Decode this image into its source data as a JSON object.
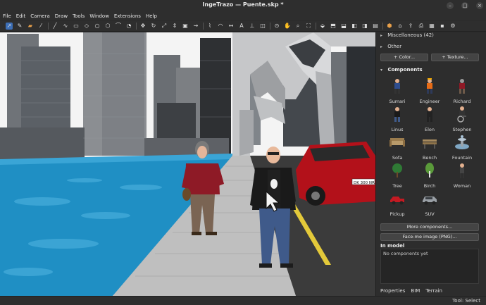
{
  "window": {
    "title": "IngeTrazo — Puente.skp *",
    "controls": [
      "minimize-icon",
      "maximize-icon",
      "close-icon"
    ]
  },
  "menu": [
    "File",
    "Edit",
    "Camera",
    "Draw",
    "Tools",
    "Window",
    "Extensions",
    "Help"
  ],
  "toolbar": {
    "tools": [
      "select-icon",
      "paint-bucket-icon",
      "eraser-icon",
      "eyedropper-icon",
      "line-icon",
      "freehand-icon",
      "rectangle-icon",
      "rotated-rectangle-icon",
      "circle-icon",
      "polygon-icon",
      "arc-icon",
      "pie-icon",
      "move-icon",
      "rotate-icon",
      "scale-icon",
      "push-pull-icon",
      "offset-icon",
      "follow-me-icon",
      "tape-measure-icon",
      "protractor-icon",
      "dimension-icon",
      "text-icon",
      "axes-icon",
      "section-plane-icon",
      "orbit-icon",
      "pan-icon",
      "zoom-icon",
      "zoom-extents-icon",
      "iso-view-icon",
      "top-view-icon",
      "front-view-icon",
      "right-view-icon",
      "back-view-icon",
      "left-view-icon",
      "paint-icon",
      "warehouse-icon",
      "share-icon",
      "export-icon",
      "print-icon",
      "save-icon",
      "settings-icon"
    ],
    "active_tool": "select-icon",
    "accent": "#3d6fb6"
  },
  "panel": {
    "materials": {
      "misc_label": "Miscellaneous",
      "misc_count": "(42)",
      "other_label": "Other",
      "color_button": "+ Color...",
      "texture_button": "+ Texture..."
    },
    "components": {
      "title": "Components",
      "items": [
        {
          "label": "Sumari",
          "icon": "person-icon"
        },
        {
          "label": "Engineer",
          "icon": "person-icon"
        },
        {
          "label": "Richard",
          "icon": "person-icon"
        },
        {
          "label": "Linus",
          "icon": "person-icon"
        },
        {
          "label": "Elon",
          "icon": "person-icon"
        },
        {
          "label": "Stephen",
          "icon": "wheelchair-person-icon"
        },
        {
          "label": "Sofa",
          "icon": "sofa-icon"
        },
        {
          "label": "Bench",
          "icon": "bench-icon"
        },
        {
          "label": "Fountain",
          "icon": "fountain-icon"
        },
        {
          "label": "Tree",
          "icon": "tree-icon"
        },
        {
          "label": "Birch",
          "icon": "birch-icon"
        },
        {
          "label": "Woman",
          "icon": "person-icon"
        },
        {
          "label": "Pickup",
          "icon": "pickup-icon"
        },
        {
          "label": "SUV",
          "icon": "suv-icon"
        }
      ],
      "more_button": "More components...",
      "face_me_button": "Face-me image (PNG)..."
    },
    "in_model": {
      "title": "In model",
      "empty_text": "No components yet"
    },
    "tabs": [
      "Properties",
      "BIM",
      "Terrain"
    ]
  },
  "viewport": {
    "plate": "DK 300 NR"
  },
  "status": {
    "text": "Tool: Select"
  }
}
